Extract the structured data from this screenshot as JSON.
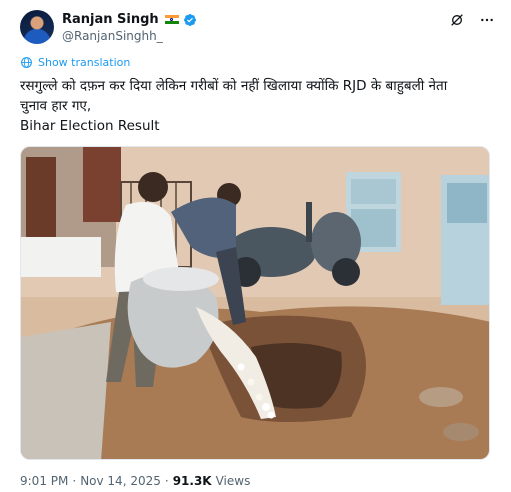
{
  "author": {
    "display_name": "Ranjan Singh",
    "handle": "@RanjanSinghh_"
  },
  "translate": {
    "label": "Show translation"
  },
  "tweet": {
    "line1": "रसगुल्ले को दफ़न कर दिया लेकिन गरीबों को नहीं खिलाया क्योंकि RJD के बाहुबली नेता",
    "line2": "चुनाव हार गए,",
    "line3": "Bihar Election Result"
  },
  "meta": {
    "time": "9:01 PM",
    "separator1": "·",
    "date": "Nov 14, 2025",
    "separator2": "·",
    "views_count": "91.3K",
    "views_label": "Views"
  },
  "colors": {
    "accent": "#1d9bf0",
    "text": "#0f1419",
    "muted": "#536471"
  },
  "icons": {
    "verified": "verified-badge-icon",
    "grok": "grok-icon",
    "more": "more-dots-icon",
    "translate": "globe-icon"
  }
}
